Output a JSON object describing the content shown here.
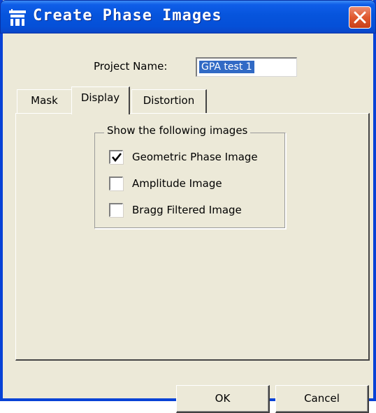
{
  "window": {
    "title": "Create Phase Images",
    "title_icon": "app-icon",
    "close_icon": "close-icon",
    "colors": {
      "titlebar": "#0654DC",
      "face": "#ECE9D8",
      "close": "#E0582E",
      "selection": "#316AC5"
    }
  },
  "project": {
    "label": "Project Name:",
    "value": "GPA test 1"
  },
  "tabs": [
    {
      "label": "Mask",
      "selected": false
    },
    {
      "label": "Display",
      "selected": true
    },
    {
      "label": "Distortion",
      "selected": false
    }
  ],
  "display_group": {
    "legend": "Show the following images",
    "options": [
      {
        "label": "Geometric Phase Image",
        "checked": true
      },
      {
        "label": "Amplitude Image",
        "checked": false
      },
      {
        "label": "Bragg Filtered Image",
        "checked": false
      }
    ]
  },
  "buttons": {
    "ok": "OK",
    "cancel": "Cancel"
  }
}
